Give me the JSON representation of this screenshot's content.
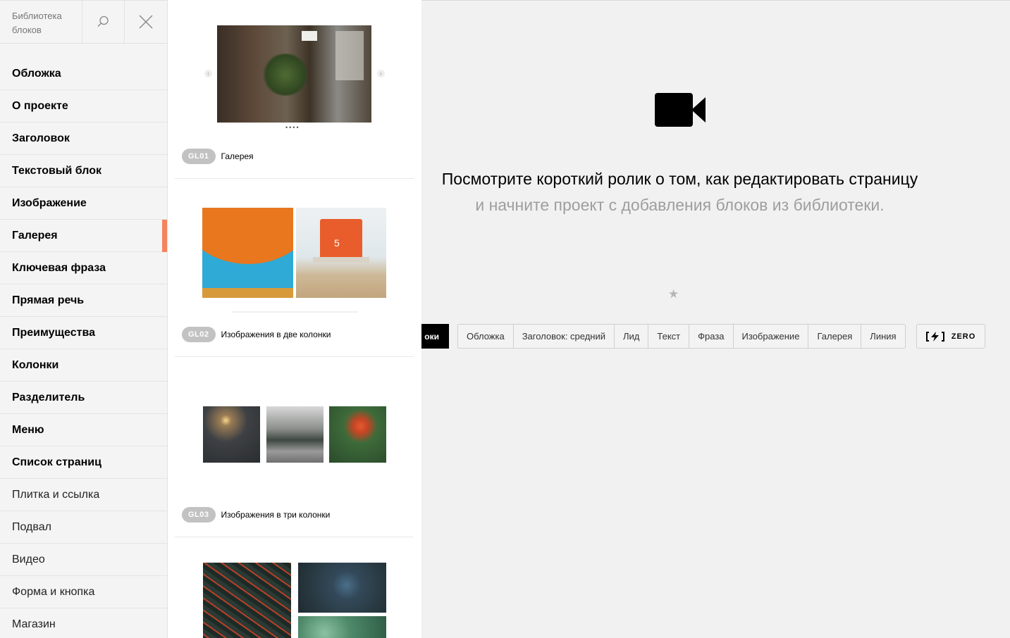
{
  "sidebar": {
    "title": "Библиотека блоков",
    "items": [
      {
        "label": "Обложка",
        "weight": "bold"
      },
      {
        "label": "О проекте",
        "weight": "bold"
      },
      {
        "label": "Заголовок",
        "weight": "bold"
      },
      {
        "label": "Текстовый блок",
        "weight": "bold"
      },
      {
        "label": "Изображение",
        "weight": "bold"
      },
      {
        "label": "Галерея",
        "weight": "bold",
        "active": true
      },
      {
        "label": "Ключевая фраза",
        "weight": "bold"
      },
      {
        "label": "Прямая речь",
        "weight": "bold"
      },
      {
        "label": "Преимущества",
        "weight": "bold"
      },
      {
        "label": "Колонки",
        "weight": "bold"
      },
      {
        "label": "Разделитель",
        "weight": "bold"
      },
      {
        "label": "Меню",
        "weight": "bold"
      },
      {
        "label": "Список страниц",
        "weight": "bold"
      },
      {
        "label": "Плитка и ссылка",
        "weight": "normal"
      },
      {
        "label": "Подвал",
        "weight": "normal"
      },
      {
        "label": "Видео",
        "weight": "normal"
      },
      {
        "label": "Форма и кнопка",
        "weight": "normal"
      },
      {
        "label": "Магазин",
        "weight": "normal"
      }
    ]
  },
  "blocks": [
    {
      "code": "GL01",
      "name": "Галерея"
    },
    {
      "code": "GL02",
      "name": "Изображения в две колонки"
    },
    {
      "code": "GL03",
      "name": "Изображения в три колонки"
    }
  ],
  "main": {
    "headline": "Посмотрите короткий ролик о том, как редактировать страницу",
    "subline": "и начните проект с добавления блоков из библиотеки.",
    "all_blocks_label": "оки",
    "quick_buttons": [
      "Обложка",
      "Заголовок: средний",
      "Лид",
      "Текст",
      "Фраза",
      "Изображение",
      "Галерея",
      "Линия"
    ],
    "zero_label": "ZERO"
  },
  "colors": {
    "accent": "#f4845f",
    "badge": "#c2c2c2"
  },
  "icons": {
    "search": "search-icon",
    "close": "close-icon",
    "video": "video-camera-icon",
    "star": "star-icon",
    "zero": "zero-block-icon"
  }
}
